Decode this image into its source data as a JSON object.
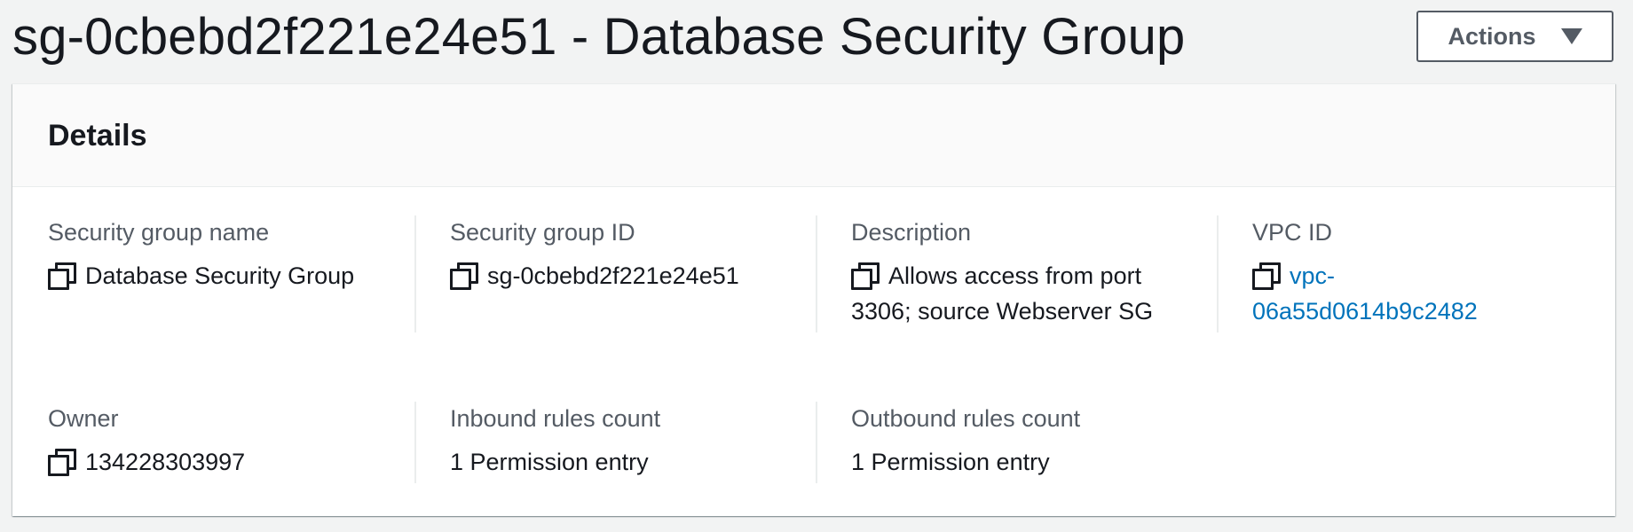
{
  "header": {
    "title": "sg-0cbebd2f221e24e51 - Database Security Group",
    "actions_label": "Actions"
  },
  "details": {
    "title": "Details",
    "fields": {
      "security_group_name": {
        "label": "Security group name",
        "value": "Database Security Group"
      },
      "security_group_id": {
        "label": "Security group ID",
        "value": "sg-0cbebd2f221e24e51"
      },
      "description": {
        "label": "Description",
        "value_line1": "Allows access from port",
        "value_line2": "3306; source Webserver SG"
      },
      "vpc_id": {
        "label": "VPC ID",
        "value_line1": "vpc-",
        "value_line2": "06a55d0614b9c2482"
      },
      "owner": {
        "label": "Owner",
        "value": "134228303997"
      },
      "inbound_rules_count": {
        "label": "Inbound rules count",
        "value": "1 Permission entry"
      },
      "outbound_rules_count": {
        "label": "Outbound rules count",
        "value": "1 Permission entry"
      }
    }
  },
  "colors": {
    "background": "#f2f3f3",
    "link": "#0073bb",
    "label": "#545b64",
    "text": "#16191f"
  },
  "icons": {
    "copy": "copy-icon",
    "dropdown": "caret-down-icon"
  }
}
